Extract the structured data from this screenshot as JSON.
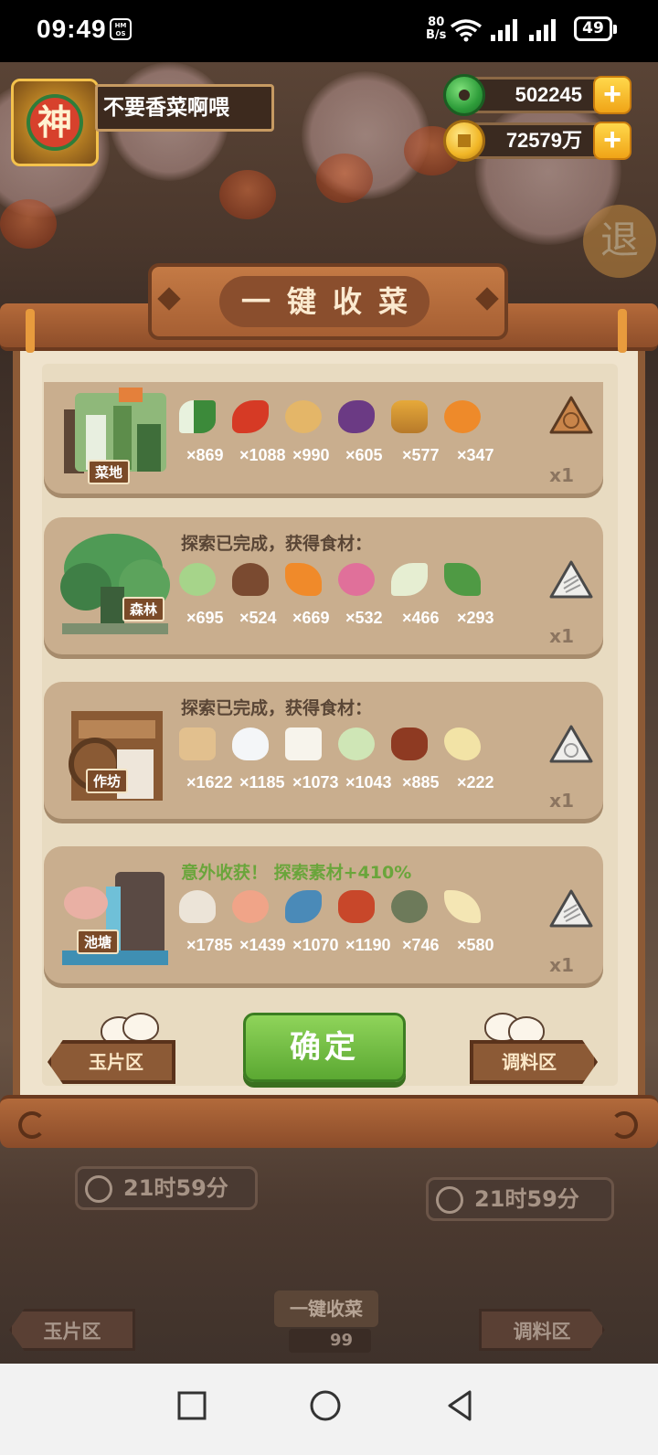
{
  "status_bar": {
    "time": "09:49",
    "hms_badge": "HM OS",
    "net_speed_value": "80",
    "net_speed_unit": "B/s",
    "battery": "49"
  },
  "player": {
    "avatar_char": "神",
    "nickname": "不要香菜啊喂"
  },
  "currency": {
    "jade": "502245",
    "gold": "72579万"
  },
  "exit_char": "退",
  "dialog": {
    "title": "一键收菜",
    "confirm_label": "确定",
    "left_nav": "玉片区",
    "right_nav": "调料区"
  },
  "cards": [
    {
      "scene_label": "菜地",
      "message": "",
      "ingredients": [
        {
          "icon": "scallion-icon",
          "count": "×869"
        },
        {
          "icon": "chili-pepper-icon",
          "count": "×1088"
        },
        {
          "icon": "potato-icon",
          "count": "×990"
        },
        {
          "icon": "eggplant-icon",
          "count": "×605"
        },
        {
          "icon": "pineapple-basket-icon",
          "count": "×577"
        },
        {
          "icon": "orange-icon",
          "count": "×347"
        }
      ],
      "multiplier": "x1"
    },
    {
      "scene_label": "森林",
      "message": "探索已完成，获得食材：",
      "ingredients": [
        {
          "icon": "cabbage-icon",
          "count": "×695"
        },
        {
          "icon": "mushroom-icon",
          "count": "×524"
        },
        {
          "icon": "carrot-icon",
          "count": "×669"
        },
        {
          "icon": "radish-icon",
          "count": "×532"
        },
        {
          "icon": "bamboo-shoot-icon",
          "count": "×466"
        },
        {
          "icon": "herb-icon",
          "count": "×293"
        }
      ],
      "multiplier": "x1"
    },
    {
      "scene_label": "作坊",
      "message": "探索已完成，获得食材：",
      "ingredients": [
        {
          "icon": "flour-sack-icon",
          "count": "×1622"
        },
        {
          "icon": "rice-bowl-icon",
          "count": "×1185"
        },
        {
          "icon": "tofu-icon",
          "count": "×1073"
        },
        {
          "icon": "rice-dish-icon",
          "count": "×1043"
        },
        {
          "icon": "sauce-jar-icon",
          "count": "×885"
        },
        {
          "icon": "gravy-boat-icon",
          "count": "×222"
        }
      ],
      "multiplier": "x1"
    },
    {
      "scene_label": "池塘",
      "message": "意外收获！ 探索素材+410%",
      "ingredients": [
        {
          "icon": "clam-icon",
          "count": "×1785"
        },
        {
          "icon": "shrimp-icon",
          "count": "×1439"
        },
        {
          "icon": "fish-icon",
          "count": "×1070"
        },
        {
          "icon": "meat-icon",
          "count": "×1190"
        },
        {
          "icon": "crab-icon",
          "count": "×746"
        },
        {
          "icon": "fin-icon",
          "count": "×580"
        }
      ],
      "multiplier": "x1"
    }
  ],
  "background": {
    "timer_left": "21时59分",
    "timer_right": "21时59分",
    "left_nav": "玉片区",
    "right_nav": "调料区",
    "harvest_all": "一键收菜",
    "harvest_count": "99"
  },
  "colors": {
    "accent_green": "#5ba832",
    "bonus_text": "#6aa53b",
    "wood": "#8c5a36",
    "card": "#c9ae8e"
  }
}
